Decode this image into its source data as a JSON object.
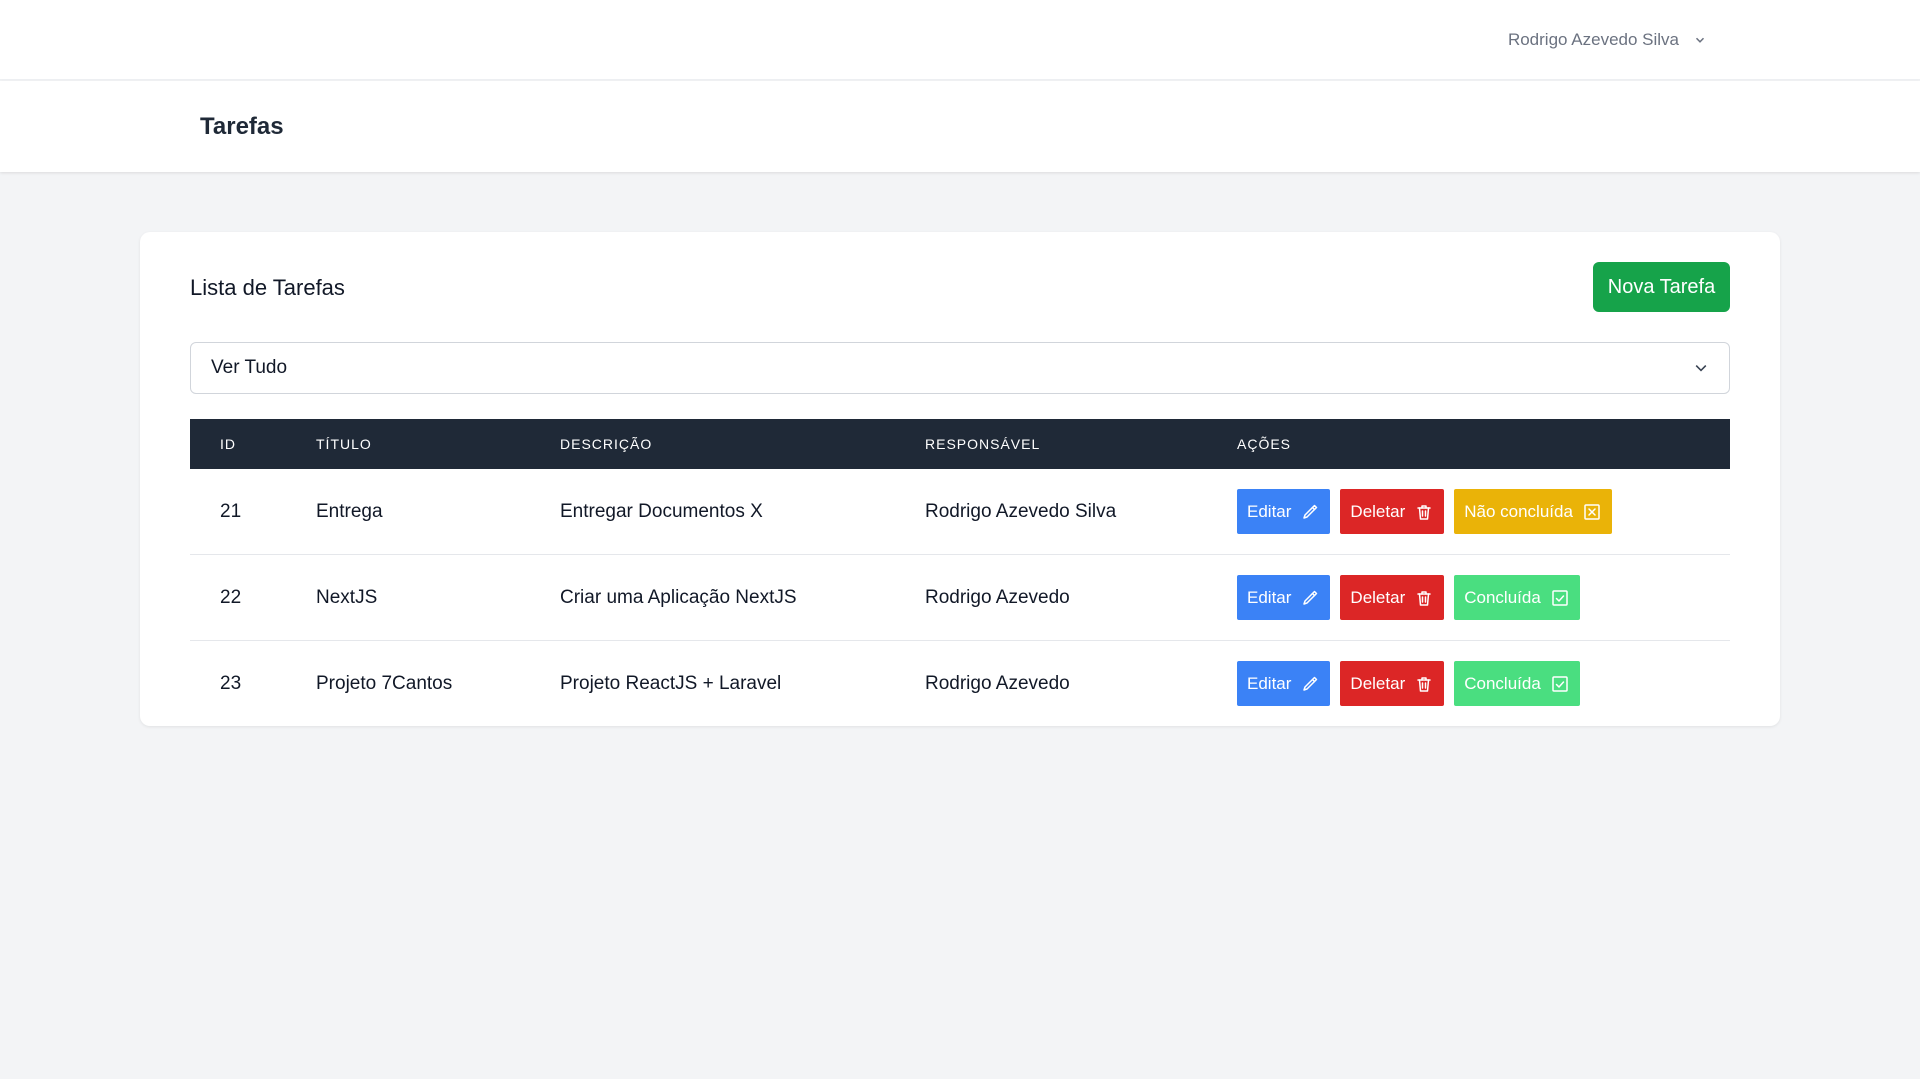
{
  "user": {
    "name": "Rodrigo Azevedo Silva"
  },
  "header": {
    "title": "Tarefas"
  },
  "card": {
    "title": "Lista de Tarefas",
    "new_button": "Nova Tarefa",
    "filter": {
      "selected": "Ver Tudo"
    }
  },
  "table": {
    "columns": [
      "ID",
      "TÍTULO",
      "DESCRIÇÃO",
      "RESPONSÁVEL",
      "AÇÕES"
    ],
    "rows": [
      {
        "id": "21",
        "title": "Entrega",
        "description": "Entregar Documentos X",
        "responsible": "Rodrigo Azevedo Silva",
        "edit": "Editar",
        "delete": "Deletar",
        "status": "Não concluída",
        "status_icon": "x-square-icon"
      },
      {
        "id": "22",
        "title": "NextJS",
        "description": "Criar uma Aplicação NextJS",
        "responsible": "Rodrigo Azevedo",
        "edit": "Editar",
        "delete": "Deletar",
        "status": "Concluída",
        "status_icon": "check-square-icon"
      },
      {
        "id": "23",
        "title": "Projeto 7Cantos",
        "description": "Projeto ReactJS + Laravel",
        "responsible": "Rodrigo Azevedo",
        "edit": "Editar",
        "delete": "Deletar",
        "status": "Concluída",
        "status_icon": "check-square-icon"
      }
    ]
  },
  "colors": {
    "edit": "#3b82f6",
    "delete": "#dc2626",
    "pending": "#eab308",
    "done": "#4ade80",
    "primary": "#16a34a",
    "table_header": "#1f2937"
  }
}
